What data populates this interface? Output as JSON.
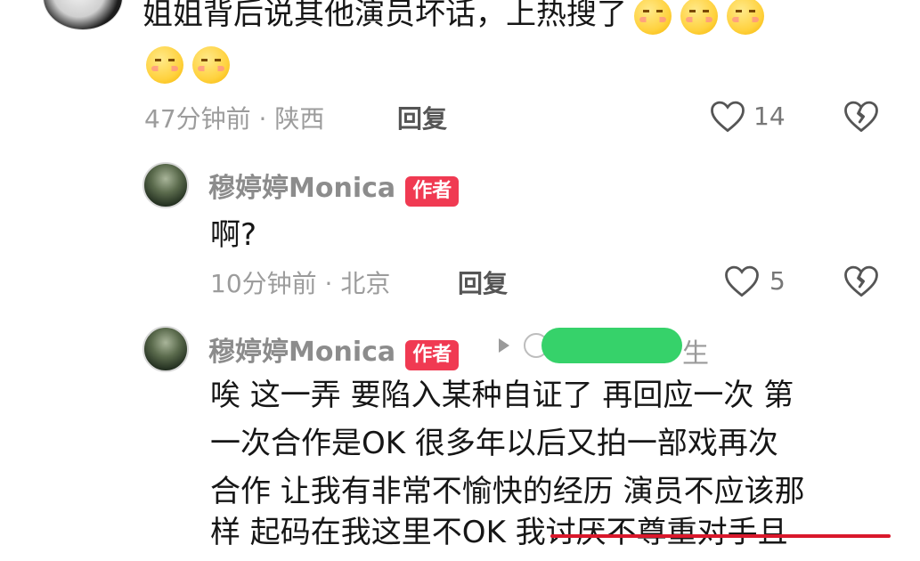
{
  "comment1": {
    "text": "姐姐背后说其他演员坏话，上热搜了",
    "time": "47分钟前",
    "location": "陕西",
    "reply_label": "回复",
    "likes": "14"
  },
  "reply1": {
    "username": "穆婷婷Monica",
    "author_badge": "作者",
    "text": "啊?",
    "time": "10分钟前",
    "location": "北京",
    "reply_label": "回复",
    "likes": "5"
  },
  "reply2": {
    "username": "穆婷婷Monica",
    "author_badge": "作者",
    "reply_to_suffix": "生",
    "text_lines": [
      "唉 这一弄 要陷入某种自证了 再回应一次 第",
      "一次合作是OK 很多年以后又拍一部戏再次",
      "合作 让我有非常不愉快的经历 演员不应该那"
    ],
    "line4_plain": "样 起码在我这里不OK ",
    "line4_underlined": "我讨厌不尊重对手且"
  },
  "icons": {
    "like": "heart-icon",
    "dislike": "broken-heart-icon",
    "arrow": "play-arrow-icon",
    "emoji": "blushing-face-emoji"
  },
  "colors": {
    "badge": "#f03a52",
    "underline": "#d9182b",
    "redaction": "#36d26a"
  }
}
